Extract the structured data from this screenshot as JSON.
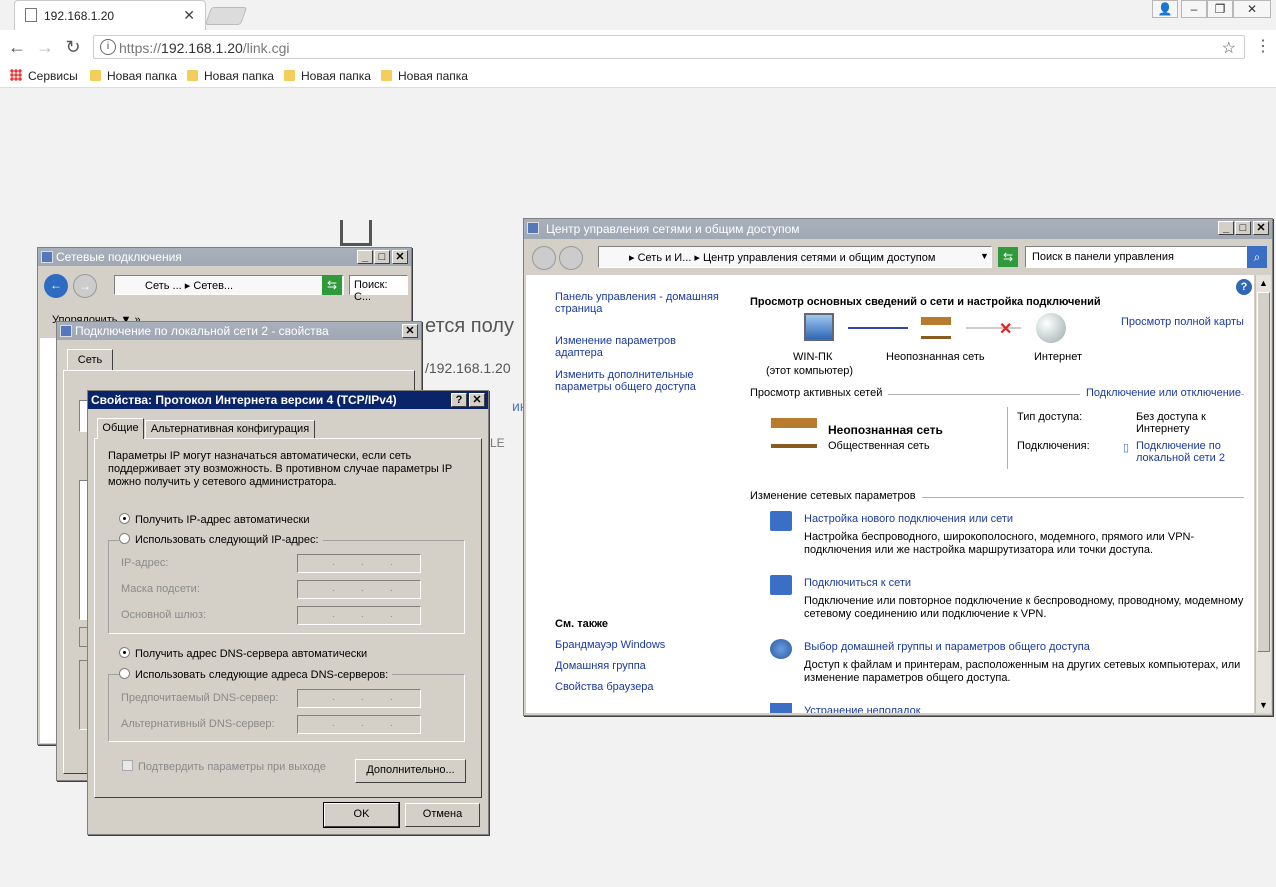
{
  "browser": {
    "tab_title": "192.168.1.20",
    "url_scheme": "https://",
    "url_host": "192.168.1.20",
    "url_path": "/link.cgi",
    "bookmarks": [
      "Сервисы",
      "Новая папка",
      "Новая папка",
      "Новая папка",
      "Новая папка"
    ]
  },
  "page_bg": {
    "partial_heading": "ется полу",
    "partial_ip": "/192.168.1.20",
    "partial_link": "ику се",
    "partial_text": "LE"
  },
  "net_connections": {
    "title": "Сетевые подключения",
    "breadcrumb_a": "Сеть ...",
    "breadcrumb_b": "Сетев...",
    "search_placeholder": "Поиск: С...",
    "organize_label": "Упорядочить"
  },
  "lan_props": {
    "title": "Подключение по локальной сети 2 - свойства",
    "tab_network": "Сеть"
  },
  "ipv4": {
    "title": "Свойства: Протокол Интернета версии 4 (TCP/IPv4)",
    "tab_general": "Общие",
    "tab_alt": "Альтернативная конфигурация",
    "description": "Параметры IP могут назначаться автоматически, если сеть поддерживает эту возможность. В противном случае параметры IP можно получить у сетевого администратора.",
    "radio_auto_ip": "Получить IP-адрес автоматически",
    "radio_manual_ip": "Использовать следующий IP-адрес:",
    "ip_label": "IP-адрес:",
    "mask_label": "Маска подсети:",
    "gateway_label": "Основной шлюз:",
    "radio_auto_dns": "Получить адрес DNS-сервера автоматически",
    "radio_manual_dns": "Использовать следующие адреса DNS-серверов:",
    "pref_dns_label": "Предпочитаемый DNS-сервер:",
    "alt_dns_label": "Альтернативный DNS-сервер:",
    "validate_label": "Подтвердить параметры при выходе",
    "advanced_button": "Дополнительно...",
    "ok_button": "OK",
    "cancel_button": "Отмена"
  },
  "netcenter": {
    "title": "Центр управления сетями и общим доступом",
    "breadcrumb_a": "Сеть и И...",
    "breadcrumb_b": "Центр управления сетями и общим доступом",
    "search_placeholder": "Поиск в панели управления",
    "left_links": [
      "Панель управления - домашняя страница",
      "Изменение параметров адаптера",
      "Изменить дополнительные параметры общего доступа"
    ],
    "see_also_heading": "См. также",
    "see_also_links": [
      "Брандмауэр Windows",
      "Домашняя группа",
      "Свойства браузера"
    ],
    "main_heading": "Просмотр основных сведений о сети и настройка подключений",
    "full_map_link": "Просмотр полной карты",
    "node_pc": "WIN-ПК",
    "node_pc_sub": "(этот компьютер)",
    "node_network": "Неопознанная сеть",
    "node_internet": "Интернет",
    "active_networks_label": "Просмотр активных сетей",
    "connect_disconnect_link": "Подключение или отключение",
    "network_name": "Неопознанная сеть",
    "network_type": "Общественная сеть",
    "access_type_label": "Тип доступа:",
    "access_type_value": "Без доступа к Интернету",
    "connections_label": "Подключения:",
    "connections_value": "Подключение по локальной сети 2",
    "change_settings_label": "Изменение сетевых параметров",
    "tasks": [
      {
        "title": "Настройка нового подключения или сети",
        "desc": "Настройка беспроводного, широкополосного, модемного, прямого или VPN-подключения или же настройка маршрутизатора или точки доступа."
      },
      {
        "title": "Подключиться к сети",
        "desc": "Подключение или повторное подключение к беспроводному, проводному, модемному сетевому соединению или подключение к VPN."
      },
      {
        "title": "Выбор домашней группы и параметров общего доступа",
        "desc": "Доступ к файлам и принтерам, расположенным на других сетевых компьютерах, или изменение параметров общего доступа."
      },
      {
        "title": "Устранение неполадок",
        "desc": ""
      }
    ]
  }
}
